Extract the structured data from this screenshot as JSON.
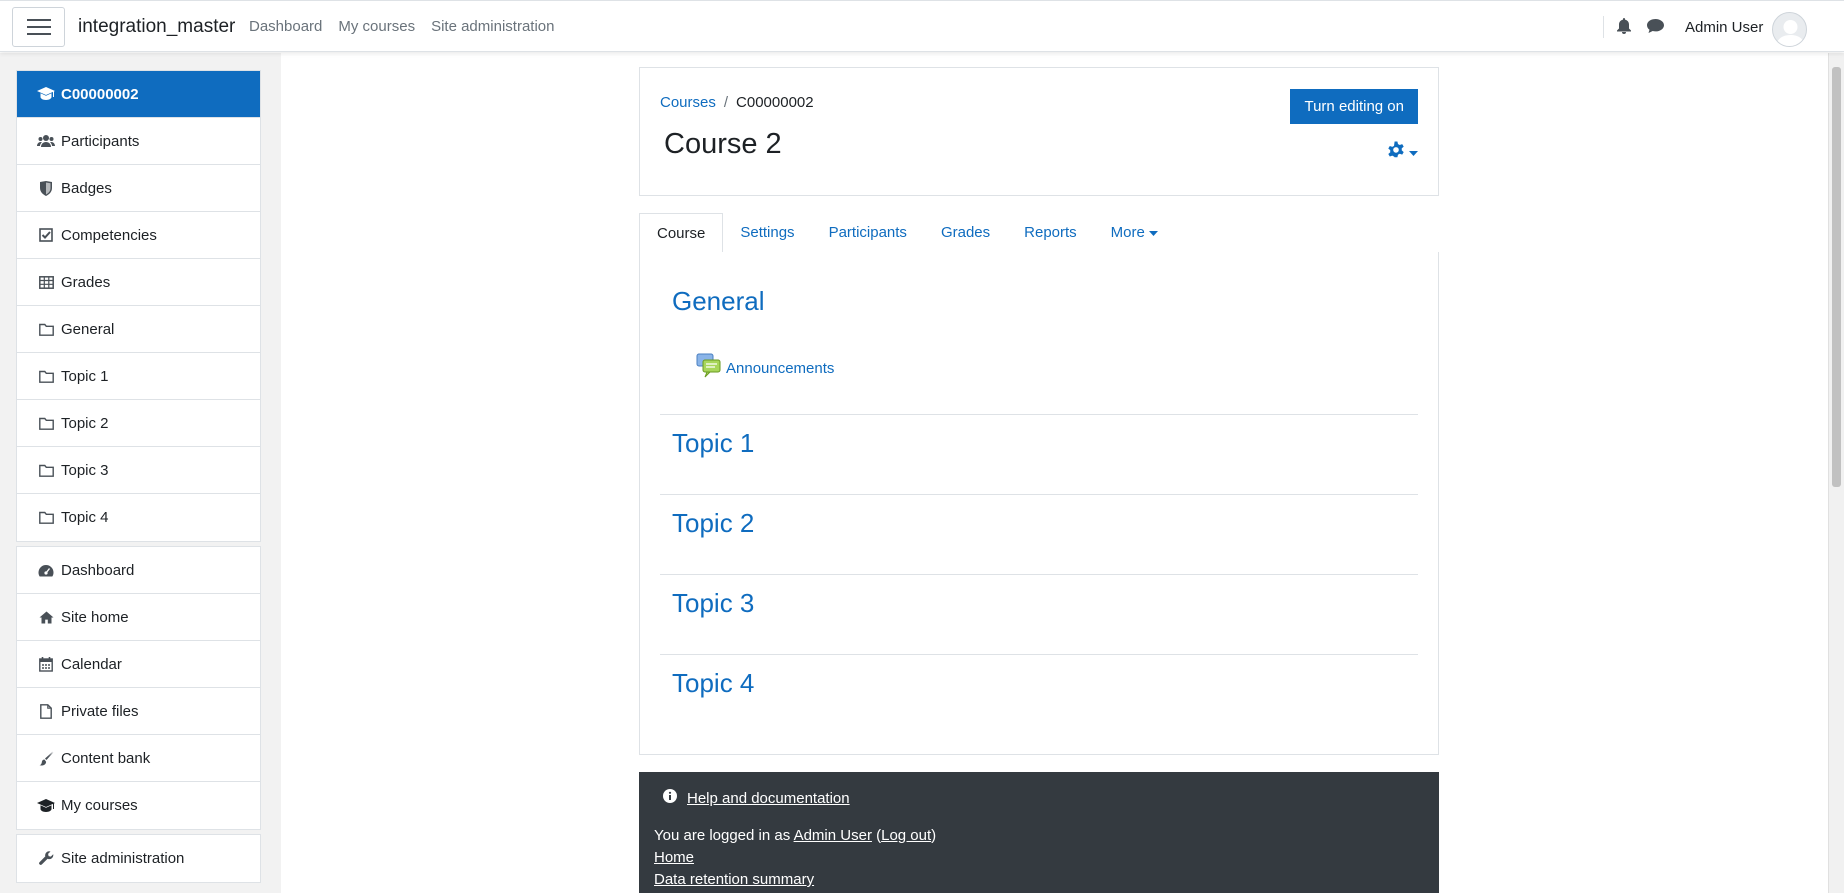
{
  "navbar": {
    "site_name": "integration_master",
    "links": [
      "Dashboard",
      "My courses",
      "Site administration"
    ],
    "user_name": "Admin User"
  },
  "drawer": {
    "course_items": [
      {
        "label": "C00000002",
        "icon": "graduation-cap-icon",
        "active": true
      },
      {
        "label": "Participants",
        "icon": "users-icon"
      },
      {
        "label": "Badges",
        "icon": "shield-icon"
      },
      {
        "label": "Competencies",
        "icon": "check-square-icon"
      },
      {
        "label": "Grades",
        "icon": "table-icon"
      },
      {
        "label": "General",
        "icon": "folder-icon"
      },
      {
        "label": "Topic 1",
        "icon": "folder-icon"
      },
      {
        "label": "Topic 2",
        "icon": "folder-icon"
      },
      {
        "label": "Topic 3",
        "icon": "folder-icon"
      },
      {
        "label": "Topic 4",
        "icon": "folder-icon"
      }
    ],
    "site_items": [
      {
        "label": "Dashboard",
        "icon": "tachometer-icon"
      },
      {
        "label": "Site home",
        "icon": "home-icon"
      },
      {
        "label": "Calendar",
        "icon": "calendar-icon"
      },
      {
        "label": "Private files",
        "icon": "file-icon"
      },
      {
        "label": "Content bank",
        "icon": "paint-brush-icon"
      },
      {
        "label": "My courses",
        "icon": "graduation-cap-icon"
      }
    ],
    "admin_items": [
      {
        "label": "Site administration",
        "icon": "wrench-icon"
      }
    ]
  },
  "header": {
    "breadcrumb_root": "Courses",
    "breadcrumb_current": "C00000002",
    "title": "Course 2",
    "edit_button": "Turn editing on"
  },
  "tabs": {
    "course": "Course",
    "settings": "Settings",
    "participants": "Participants",
    "grades": "Grades",
    "reports": "Reports",
    "more": "More"
  },
  "sections": {
    "general": "General",
    "announcements": "Announcements",
    "topic1": "Topic 1",
    "topic2": "Topic 2",
    "topic3": "Topic 3",
    "topic4": "Topic 4"
  },
  "footer": {
    "help": "Help and documentation",
    "logged_in_prefix": "You are logged in as ",
    "logged_in_user": "Admin User",
    "logout_open": " (",
    "logout": "Log out",
    "logout_close": ")",
    "home": "Home",
    "data_retention": "Data retention summary"
  },
  "colors": {
    "accent": "#0f6cbf",
    "footer_bg": "#343a40",
    "drawer_bg": "#f2f2f2"
  }
}
